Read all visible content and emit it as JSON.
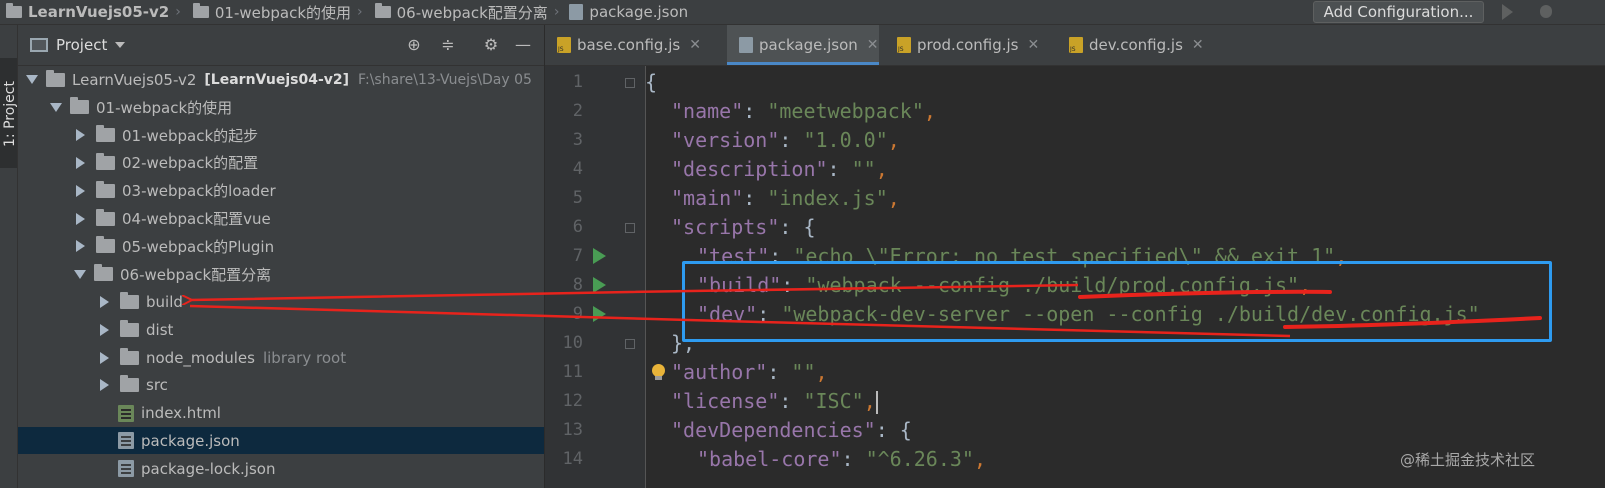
{
  "navbar": {
    "crumbs": [
      "LearnVuejs05-v2",
      "01-webpack的使用",
      "06-webpack配置分离",
      "package.json"
    ],
    "add_config_label": "Add Configuration..."
  },
  "tool_strip": {
    "project_tab_label": "1: Project"
  },
  "project_panel": {
    "title": "Project",
    "tree": [
      {
        "label": "LearnVuejs05-v2",
        "bold": "[LearnVuejs04-v2]",
        "hint": "F:\\share\\13-Vuejs\\Day 05",
        "type": "folder",
        "state": "expanded",
        "indent": 0
      },
      {
        "label": "01-webpack的使用",
        "type": "folder",
        "state": "expanded",
        "indent": 1
      },
      {
        "label": "01-webpack的起步",
        "type": "folder",
        "state": "collapsed",
        "indent": 2
      },
      {
        "label": "02-webpack的配置",
        "type": "folder",
        "state": "collapsed",
        "indent": 2
      },
      {
        "label": "03-webpack的loader",
        "type": "folder",
        "state": "collapsed",
        "indent": 2
      },
      {
        "label": "04-webpack配置vue",
        "type": "folder",
        "state": "collapsed",
        "indent": 2
      },
      {
        "label": "05-webpack的Plugin",
        "type": "folder",
        "state": "collapsed",
        "indent": 2
      },
      {
        "label": "06-webpack配置分离",
        "type": "folder",
        "state": "expanded",
        "indent": 2
      },
      {
        "label": "build",
        "type": "folder",
        "state": "collapsed",
        "indent": 3
      },
      {
        "label": "dist",
        "type": "folder",
        "state": "collapsed",
        "indent": 3
      },
      {
        "label": "node_modules",
        "lib": "library root",
        "type": "folder",
        "state": "collapsed",
        "indent": 3
      },
      {
        "label": "src",
        "type": "folder",
        "state": "collapsed",
        "indent": 3
      },
      {
        "label": "index.html",
        "type": "html",
        "state": "none",
        "indent": 3
      },
      {
        "label": "package.json",
        "type": "json",
        "state": "none",
        "indent": 3,
        "selected": true
      },
      {
        "label": "package-lock.json",
        "type": "json",
        "state": "none",
        "indent": 3
      }
    ]
  },
  "editor": {
    "tabs": [
      {
        "label": "base.config.js",
        "icon": "js-icon",
        "active": false
      },
      {
        "label": "package.json",
        "icon": "json-icon",
        "active": true
      },
      {
        "label": "prod.config.js",
        "icon": "js-icon",
        "active": false
      },
      {
        "label": "dev.config.js",
        "icon": "js-icon",
        "active": false
      }
    ],
    "lines": [
      {
        "n": "1",
        "indent": 0,
        "tokens": [
          {
            "t": "{",
            "c": "b"
          }
        ]
      },
      {
        "n": "2",
        "indent": 1,
        "tokens": [
          {
            "t": "\"name\"",
            "c": "k"
          },
          {
            "t": ": ",
            "c": "b"
          },
          {
            "t": "\"meetwebpack\"",
            "c": "s"
          },
          {
            "t": ",",
            "c": "p"
          }
        ]
      },
      {
        "n": "3",
        "indent": 1,
        "tokens": [
          {
            "t": "\"version\"",
            "c": "k"
          },
          {
            "t": ": ",
            "c": "b"
          },
          {
            "t": "\"1.0.0\"",
            "c": "s"
          },
          {
            "t": ",",
            "c": "p"
          }
        ]
      },
      {
        "n": "4",
        "indent": 1,
        "tokens": [
          {
            "t": "\"description\"",
            "c": "k"
          },
          {
            "t": ": ",
            "c": "b"
          },
          {
            "t": "\"\"",
            "c": "s"
          },
          {
            "t": ",",
            "c": "p"
          }
        ]
      },
      {
        "n": "5",
        "indent": 1,
        "tokens": [
          {
            "t": "\"main\"",
            "c": "k"
          },
          {
            "t": ": ",
            "c": "b"
          },
          {
            "t": "\"index.js\"",
            "c": "s"
          },
          {
            "t": ",",
            "c": "p"
          }
        ]
      },
      {
        "n": "6",
        "indent": 1,
        "tokens": [
          {
            "t": "\"scripts\"",
            "c": "k"
          },
          {
            "t": ": {",
            "c": "b"
          }
        ]
      },
      {
        "n": "7",
        "indent": 2,
        "tokens": [
          {
            "t": "\"test\"",
            "c": "k"
          },
          {
            "t": ": ",
            "c": "b"
          },
          {
            "t": "\"echo \\\"Error: no test specified\\\" && exit 1\"",
            "c": "s"
          },
          {
            "t": ",",
            "c": "p"
          }
        ]
      },
      {
        "n": "8",
        "indent": 2,
        "tokens": [
          {
            "t": "\"build\"",
            "c": "k"
          },
          {
            "t": ": ",
            "c": "b"
          },
          {
            "t": "\"webpack --config ./build/prod.config.js\"",
            "c": "s"
          },
          {
            "t": ",",
            "c": "p"
          }
        ]
      },
      {
        "n": "9",
        "indent": 2,
        "tokens": [
          {
            "t": "\"dev\"",
            "c": "k"
          },
          {
            "t": ": ",
            "c": "b"
          },
          {
            "t": "\"webpack-dev-server --open --config ./build/dev.config.js\"",
            "c": "s"
          }
        ]
      },
      {
        "n": "10",
        "indent": 1,
        "tokens": [
          {
            "t": "},",
            "c": "b"
          }
        ]
      },
      {
        "n": "11",
        "indent": 1,
        "tokens": [
          {
            "t": "\"author\"",
            "c": "k"
          },
          {
            "t": ": ",
            "c": "b"
          },
          {
            "t": "\"\"",
            "c": "s"
          },
          {
            "t": ",",
            "c": "p"
          }
        ]
      },
      {
        "n": "12",
        "indent": 1,
        "tokens": [
          {
            "t": "\"license\"",
            "c": "k"
          },
          {
            "t": ": ",
            "c": "b"
          },
          {
            "t": "\"ISC\"",
            "c": "s"
          },
          {
            "t": ",",
            "c": "p"
          }
        ],
        "caret": true
      },
      {
        "n": "13",
        "indent": 1,
        "tokens": [
          {
            "t": "\"devDependencies\"",
            "c": "k"
          },
          {
            "t": ": {",
            "c": "b"
          }
        ]
      },
      {
        "n": "14",
        "indent": 2,
        "tokens": [
          {
            "t": "\"babel-core\"",
            "c": "k"
          },
          {
            "t": ": ",
            "c": "b"
          },
          {
            "t": "\"^6.26.3\"",
            "c": "s"
          },
          {
            "t": ",",
            "c": "p"
          }
        ]
      }
    ]
  },
  "watermark": "@稀土掘金技术社区",
  "colors": {
    "annotation_box": "#2e9bf0",
    "annotation_pen": "#e8231c",
    "run_marker": "#499c54"
  }
}
